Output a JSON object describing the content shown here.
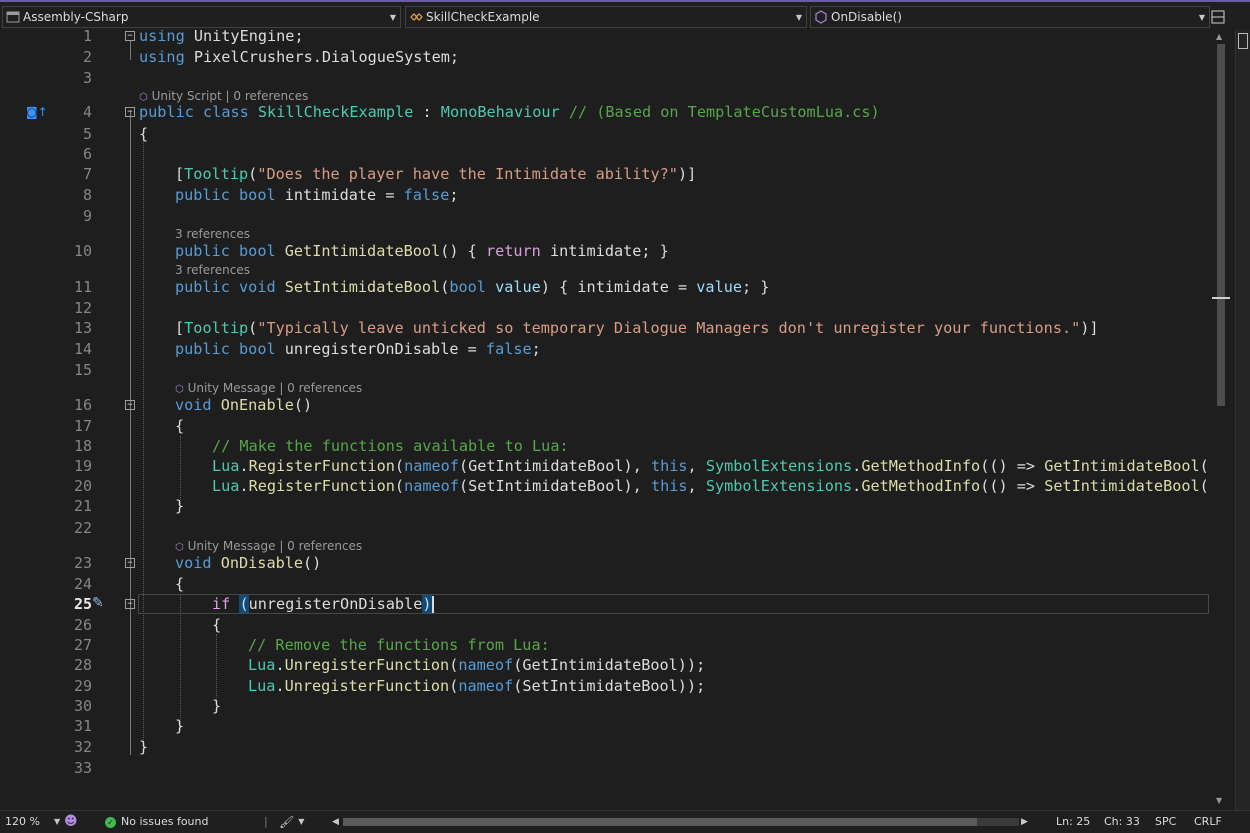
{
  "navbar": {
    "project": "Assembly-CSharp",
    "type": "SkillCheckExample",
    "member": "OnDisable()"
  },
  "icons": {
    "project": "csharp-project-icon",
    "type": "class-icon",
    "member": "method-icon",
    "split": "split-window-icon"
  },
  "lenses": {
    "l4": "Unity Script | 0 references",
    "l10": "3 references",
    "l11": "3 references",
    "l16": "Unity Message | 0 references",
    "l23": "Unity Message | 0 references"
  },
  "code": {
    "l1": {
      "kw": "using",
      "rest": " UnityEngine;"
    },
    "l2": {
      "kw": "using",
      "rest": " PixelCrushers.DialogueSystem;"
    },
    "l4": {
      "kw1": "public",
      "kw2": "class",
      "cls": "SkillCheckExample",
      "sep": " : ",
      "base": "MonoBehaviour",
      "cmt": " // (Based on TemplateCustomLua.cs)"
    },
    "l5": "{",
    "l7": {
      "open": "[",
      "attr": "Tooltip",
      "paren": "(",
      "str": "\"Does the player have the Intimidate ability?\"",
      "close": ")]"
    },
    "l8": {
      "kw1": "public",
      "kw2": "bool",
      "mid": " intimidate = ",
      "val": "false",
      "end": ";"
    },
    "l10": {
      "kw1": "public",
      "kw2": "bool",
      "name": "GetIntimidateBool",
      "p1": "() { ",
      "ret": "return",
      "p2": " intimidate; }"
    },
    "l11": {
      "kw1": "public",
      "kw2": "void",
      "name": "SetIntimidateBool",
      "p1": "(",
      "ptype": "bool",
      "pname": "value",
      "p2": ") { intimidate = ",
      "pname2": "value",
      "p3": "; }"
    },
    "l13": {
      "open": "[",
      "attr": "Tooltip",
      "paren": "(",
      "str": "\"Typically leave unticked so temporary Dialogue Managers don't unregister your functions.\"",
      "close": ")]"
    },
    "l14": {
      "kw1": "public",
      "kw2": "bool",
      "mid": " unregisterOnDisable = ",
      "val": "false",
      "end": ";"
    },
    "l16": {
      "kw": "void",
      "name": "OnEnable",
      "end": "()"
    },
    "l17": "{",
    "l18": "// Make the functions available to Lua:",
    "l19": {
      "cls": "Lua",
      "dot": ".",
      "m": "RegisterFunction",
      "p1": "(",
      "nameof": "nameof",
      "arg": "(GetIntimidateBool), ",
      "this": "this",
      "comma": ", ",
      "cls2": "SymbolExtensions",
      "dot2": ".",
      "m2": "GetMethodInfo",
      "p2": "(() => ",
      "m3": "GetIntimidateBool",
      "p3": "("
    },
    "l20": {
      "cls": "Lua",
      "dot": ".",
      "m": "RegisterFunction",
      "p1": "(",
      "nameof": "nameof",
      "arg": "(SetIntimidateBool), ",
      "this": "this",
      "comma": ", ",
      "cls2": "SymbolExtensions",
      "dot2": ".",
      "m2": "GetMethodInfo",
      "p2": "(() => ",
      "m3": "SetIntimidateBool",
      "p3": "("
    },
    "l21": "}",
    "l23": {
      "kw": "void",
      "name": "OnDisable",
      "end": "()"
    },
    "l24": "{",
    "l25": {
      "kw": "if",
      "sp": " ",
      "open": "(",
      "cond": "unregisterOnDisable",
      "close": ")"
    },
    "l26": "{",
    "l27": "// Remove the functions from Lua:",
    "l28": {
      "cls": "Lua",
      "dot": ".",
      "m": "UnregisterFunction",
      "p1": "(",
      "nameof": "nameof",
      "arg": "(GetIntimidateBool));"
    },
    "l29": {
      "cls": "Lua",
      "dot": ".",
      "m": "UnregisterFunction",
      "p1": "(",
      "nameof": "nameof",
      "arg": "(SetIntimidateBool));"
    },
    "l30": "}",
    "l31": "}",
    "l32": "}"
  },
  "line_numbers": [
    "1",
    "2",
    "3",
    "4",
    "5",
    "6",
    "7",
    "8",
    "9",
    "10",
    "11",
    "12",
    "13",
    "14",
    "15",
    "16",
    "17",
    "18",
    "19",
    "20",
    "21",
    "22",
    "23",
    "24",
    "25",
    "26",
    "27",
    "28",
    "29",
    "30",
    "31",
    "32",
    "33"
  ],
  "status": {
    "zoom": "120 %",
    "issues": "No issues found",
    "ln": "Ln: 25",
    "ch": "Ch: 33",
    "spc": "SPC",
    "eol": "CRLF"
  },
  "colors": {
    "accent": "#6d5aa6",
    "keyword": "#569cd6",
    "control_keyword": "#d8a0df",
    "type": "#4ec9b0",
    "method": "#dcdcaa",
    "string": "#d69d85",
    "comment": "#57a64a",
    "parameter": "#9cdcfe",
    "ok_status": "#3fb950"
  }
}
